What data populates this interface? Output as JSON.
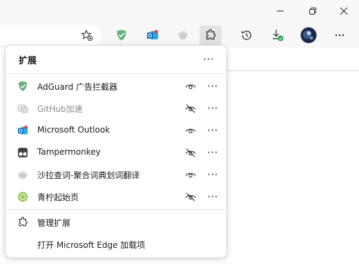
{
  "window": {
    "minimize_icon": "minimize-icon",
    "restore_icon": "restore-icon",
    "close_icon": "close-icon"
  },
  "toolbar": {
    "icons": [
      "favorite-star-icon",
      "adguard-extension-icon",
      "outlook-extension-icon",
      "translate-extension-icon",
      "extensions-puzzle-icon",
      "history-icon",
      "downloads-icon",
      "profile-avatar",
      "settings-more-icon"
    ]
  },
  "panel": {
    "title": "扩展",
    "more_label": "···",
    "extensions": [
      {
        "name": "AdGuard 广告拦截器",
        "icon": "adguard-shield-icon",
        "visible_in_toolbar": true,
        "enabled": true
      },
      {
        "name": "GitHub加速",
        "icon": "github-accelerator-icon",
        "visible_in_toolbar": false,
        "enabled": false
      },
      {
        "name": "Microsoft Outlook",
        "icon": "outlook-icon",
        "visible_in_toolbar": true,
        "enabled": true
      },
      {
        "name": "Tampermonkey",
        "icon": "tampermonkey-icon",
        "visible_in_toolbar": false,
        "enabled": true
      },
      {
        "name": "沙拉查词-聚合词典划词翻译",
        "icon": "saladict-icon",
        "visible_in_toolbar": true,
        "enabled": true
      },
      {
        "name": "青柠起始页",
        "icon": "lime-startpage-icon",
        "visible_in_toolbar": false,
        "enabled": true
      }
    ],
    "row_more_label": "···",
    "manage_label": "管理扩展",
    "get_extensions_label": "打开 Microsoft Edge 加载项"
  },
  "colors": {
    "adguard_green": "#4caf50",
    "outlook_blue": "#0f6cbd",
    "accent_green": "#1f9d55"
  }
}
